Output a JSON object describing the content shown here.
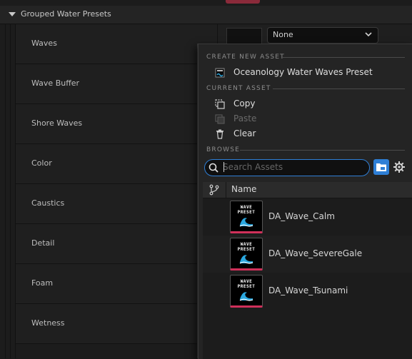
{
  "category": {
    "label": "Grouped Water Presets"
  },
  "properties": [
    {
      "label": "Waves"
    },
    {
      "label": "Wave Buffer"
    },
    {
      "label": "Shore Waves"
    },
    {
      "label": "Color"
    },
    {
      "label": "Caustics"
    },
    {
      "label": "Detail"
    },
    {
      "label": "Foam"
    },
    {
      "label": "Wetness"
    }
  ],
  "waves_picker": {
    "value": "None"
  },
  "menu": {
    "create_section": "CREATE NEW ASSET",
    "create_item": "Oceanology Water Waves Preset",
    "current_section": "CURRENT ASSET",
    "copy": "Copy",
    "paste": "Paste",
    "clear": "Clear",
    "browse_section": "BROWSE",
    "search_placeholder": "Search Assets",
    "column_name": "Name",
    "thumb_text_line1": "WAVE",
    "thumb_text_line2": "PRESET",
    "assets": [
      {
        "name": "DA_Wave_Calm"
      },
      {
        "name": "DA_Wave_SevereGale"
      },
      {
        "name": "DA_Wave_Tsunami"
      }
    ]
  },
  "colors": {
    "accent": "#2e7fd6",
    "thumb_border": "#d0305a",
    "wave_blue": "#2aa8e0"
  }
}
